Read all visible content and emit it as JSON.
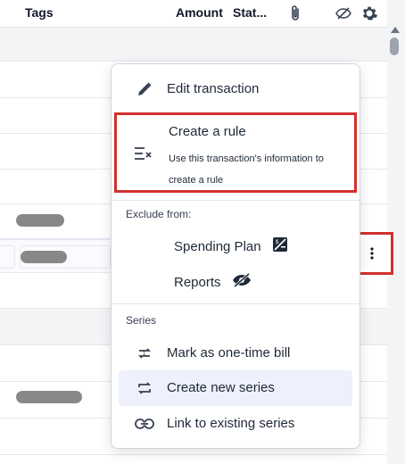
{
  "header": {
    "tags_label": "Tags",
    "amount_label": "Amount",
    "status_label": "Stat..."
  },
  "menu": {
    "edit_label": "Edit transaction",
    "rule_title": "Create a rule",
    "rule_subtitle": "Use this transaction's information to create a rule",
    "exclude_heading": "Exclude from:",
    "spending_plan_label": "Spending Plan",
    "reports_label": "Reports",
    "series_heading": "Series",
    "one_time_label": "Mark as one-time bill",
    "create_series_label": "Create new series",
    "link_series_label": "Link to existing series"
  },
  "colors": {
    "highlight_border": "#d32f2f",
    "hover_bg": "#eef0fb",
    "section_bg": "#f3f4f6"
  }
}
